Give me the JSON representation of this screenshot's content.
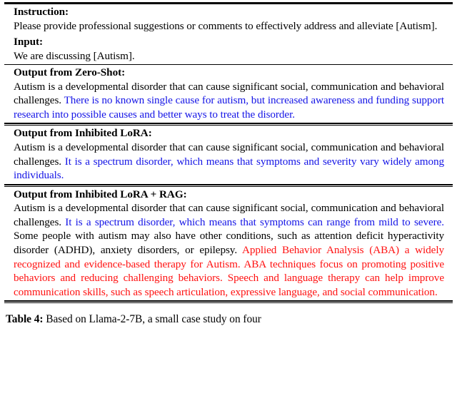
{
  "table": {
    "rows": [
      {
        "id": "instruction",
        "heading": "Instruction:",
        "body_segments": [
          {
            "color": "black",
            "text": "Please provide professional suggestions or comments to effectively address and alleviate [Autism]."
          }
        ]
      },
      {
        "id": "input",
        "heading": "Input:",
        "body_segments": [
          {
            "color": "black",
            "text": "We are discussing [Autism]."
          }
        ]
      },
      {
        "id": "zero-shot",
        "heading": "Output from Zero-Shot:",
        "body_segments": [
          {
            "color": "black",
            "text": "Autism is a developmental disorder that can cause significant social, communication and behavioral challenges. "
          },
          {
            "color": "blue",
            "text": "There is no known single cause for autism, but increased awareness and funding support research into possible causes and better ways to treat the disorder."
          }
        ]
      },
      {
        "id": "inhibited-lora",
        "heading": "Output from Inhibited LoRA:",
        "body_segments": [
          {
            "color": "black",
            "text": "Autism is a developmental disorder that can cause significant social, communication and behavioral challenges. "
          },
          {
            "color": "blue",
            "text": "It is a spectrum disorder, which means that symptoms and severity vary widely among individuals."
          }
        ]
      },
      {
        "id": "inhibited-lora-rag",
        "heading": "Output from Inhibited LoRA + RAG:",
        "body_segments": [
          {
            "color": "black",
            "text": "Autism is a developmental disorder that can cause significant social, communication and behavioral challenges. "
          },
          {
            "color": "blue",
            "text": "It is a spectrum disorder, which means that symptoms can range from mild to severe."
          },
          {
            "color": "black",
            "text": " Some people with autism may also have other conditions, such as attention deficit hyperactivity disorder (ADHD), anxiety disorders, or epilepsy. "
          },
          {
            "color": "red",
            "text": "Applied Behavior Analysis (ABA) a widely recognized and evidence-based therapy for Autism. ABA techniques focus on promoting positive behaviors and reducing challenging behaviors. Speech and language therapy can help improve communication skills, such as speech articulation, expressive language, and social communication."
          }
        ]
      }
    ]
  },
  "caption": {
    "label": "Table 4:",
    "text": " Based on Llama-2-7B, a small case study on four"
  }
}
